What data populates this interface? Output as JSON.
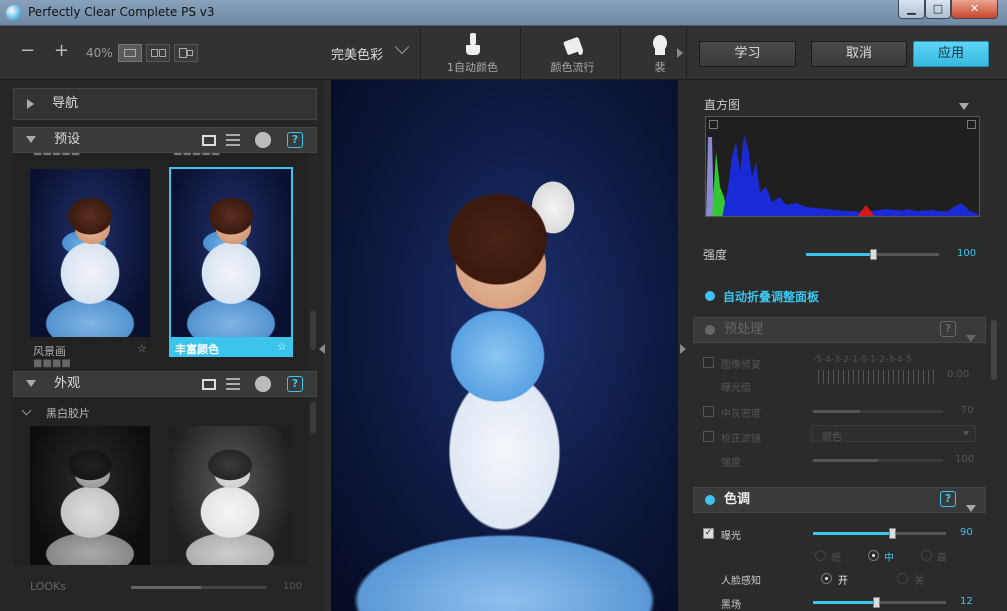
{
  "window": {
    "title": "Perfectly Clear Complete PS v3",
    "min": "▁",
    "max": "□",
    "close": "✕"
  },
  "toolbar": {
    "zoom_minus": "−",
    "zoom_plus": "+",
    "zoom_level": "40%",
    "preset_select": "完美色彩",
    "tools": [
      {
        "label": "1自动颜色"
      },
      {
        "label": "颜色流行"
      },
      {
        "label": "裴"
      }
    ],
    "learn": "学习",
    "cancel": "取消",
    "apply": "应用"
  },
  "left": {
    "nav_title": "导航",
    "presets_title": "预设",
    "presets_prev_labels": [
      "■■■■■",
      "■■■■■"
    ],
    "presets": [
      {
        "label": "风景画",
        "star": "☆"
      },
      {
        "label": "丰富颜色",
        "star": "☆"
      }
    ],
    "presets_next_label": "■■■■",
    "looks_title": "外观",
    "looks_group": "黑白胶片",
    "looks_slider_label": "LOOKs",
    "looks_slider_value": "100",
    "help": "?"
  },
  "right": {
    "histogram_title": "直方图",
    "strength_label": "强度",
    "strength_value": "100",
    "auto_collapse": "自动折叠调整面板",
    "preprocess": {
      "title": "预处理",
      "image_repair": "图像修复",
      "exposure_value_label": "曝光值",
      "exposure_value_scale": "-5-4-3-2-1-0-1-2-3-4-5",
      "exposure_value": "0.00",
      "mid_gray": "中灰密度",
      "mid_gray_value": "70",
      "correct_filter": "校正滤镜",
      "filter_option": "颜色",
      "intensity_label": "强度",
      "intensity_value": "100"
    },
    "tone": {
      "title": "色调",
      "exposure": "曝光",
      "exposure_value": "90",
      "levels": [
        "低",
        "中",
        "高"
      ],
      "face_aware": "人脸感知",
      "on": "开",
      "off": "关",
      "black_point": "黑场",
      "black_point_value": "12",
      "check": "✓"
    }
  },
  "colors": {
    "accent": "#3cc4ec",
    "background": "#2b2b2b"
  }
}
